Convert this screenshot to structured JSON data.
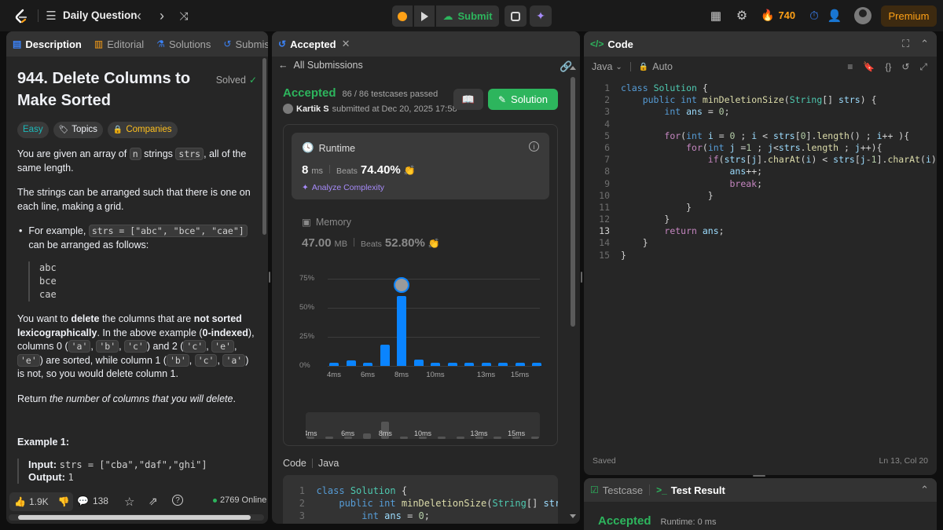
{
  "topbar": {
    "title": "Daily Question",
    "submit_label": "Submit",
    "streak": "740",
    "premium_label": "Premium"
  },
  "left": {
    "tabs": [
      {
        "label": "Description"
      },
      {
        "label": "Editorial"
      },
      {
        "label": "Solutions"
      },
      {
        "label": "Submissi"
      }
    ],
    "problem_title": "944. Delete Columns to Make Sorted",
    "solved_label": "Solved",
    "chips": {
      "difficulty": "Easy",
      "topics": "Topics",
      "companies": "Companies"
    },
    "p1": {
      "a": "You are given an array of ",
      "n": "n",
      "b": " strings ",
      "strs": "strs",
      "c": ", all of the same length."
    },
    "p2": "The strings can be arranged such that there is one on each line, making a grid.",
    "bullet": {
      "a": "For example, ",
      "code": "strs = [\"abc\", \"bce\", \"cae\"]",
      "b": " can be arranged as follows:"
    },
    "grid_lines": [
      "abc",
      "bce",
      "cae"
    ],
    "p3": {
      "a": "You want to ",
      "b": "delete",
      "c": " the columns that are ",
      "d": "not sorted lexicographically",
      "e": ". In the above example (",
      "f": "0-indexed",
      "g": "), columns 0 (",
      "c1": "'a'",
      "c2": "'b'",
      "c3": "'c'",
      "h": ") and 2 (",
      "c4": "'c'",
      "c5": "'e'",
      "c6": "'e'",
      "i": ") are sorted, while column 1 (",
      "c7": "'b'",
      "c8": "'c'",
      "c9": "'a'",
      "j": ") is not, so you would delete column 1."
    },
    "p4": {
      "a": "Return ",
      "b": "the number of columns that you will delete",
      "c": "."
    },
    "example_heading": "Example 1:",
    "example_input_label": "Input:",
    "example_input_value": "strs = [\"cba\",\"daf\",\"ghi\"]",
    "example_output_label": "Output:",
    "example_output_value": "1",
    "footer": {
      "likes": "1.9K",
      "comments": "138",
      "online": "2769 Online"
    }
  },
  "middle": {
    "tab_label": "Accepted",
    "all_submissions": "All Submissions",
    "status": "Accepted",
    "testcases": "86 / 86 testcases passed",
    "author": "Kartik S",
    "submitted_at": "submitted at Dec 20, 2025 17:58",
    "solution_label": "Solution",
    "runtime": {
      "label": "Runtime",
      "value": "8",
      "unit": "ms",
      "beats_label": "Beats",
      "beats": "74.40%",
      "analyze": "Analyze Complexity"
    },
    "memory": {
      "label": "Memory",
      "value": "47.00",
      "unit": "MB",
      "beats_label": "Beats",
      "beats": "52.80%"
    },
    "code_label": "Code",
    "code_lang": "Java",
    "code_preview": [
      "class Solution {",
      "    public int minDeletionSize(String[] strs",
      "        int ans = 0;"
    ]
  },
  "chart_data": {
    "type": "bar",
    "title": "",
    "xlabel": "",
    "ylabel": "",
    "ylim": [
      0,
      75
    ],
    "yticks": [
      "75%",
      "50%",
      "25%",
      "0%"
    ],
    "categories": [
      "4ms",
      "5ms",
      "6ms",
      "7ms",
      "8ms",
      "9ms",
      "10ms",
      "11ms",
      "12ms",
      "13ms",
      "14ms",
      "15ms",
      "16ms"
    ],
    "x_tick_labels": [
      "4ms",
      "6ms",
      "8ms",
      "10ms",
      "13ms",
      "15ms"
    ],
    "values": [
      2.5,
      4.5,
      3.0,
      18.5,
      60.0,
      5.5,
      2.5,
      2.5,
      2.5,
      2.5,
      2.5,
      2.5,
      2.5
    ],
    "highlight_category": "8ms",
    "bar_color": "#0a84ff",
    "grid": true
  },
  "right": {
    "tab_label": "Code",
    "language": "Java",
    "auto_label": "Auto",
    "code_lines": [
      "class Solution {",
      "    public int minDeletionSize(String[] strs) {",
      "        int ans = 0;",
      "",
      "        for(int i = 0 ; i < strs[0].length() ; i++ ){",
      "            for(int j =1 ; j<strs.length ; j++){",
      "                if(strs[j].charAt(i) < strs[j-1].charAt(i)){",
      "                    ans++;",
      "                    break;",
      "                }",
      "            }",
      "        }",
      "        return ans;",
      "    }",
      "}"
    ],
    "saved_label": "Saved",
    "cursor_pos": "Ln 13, Col 20",
    "bottom_tabs": {
      "testcase": "Testcase",
      "result": "Test Result"
    },
    "bottom_status": "Accepted",
    "bottom_runtime": "Runtime: 0 ms"
  },
  "colors": {
    "accent_green": "#2db55d",
    "easy_teal": "#1cbaba",
    "beats_gold": "#ffc01e",
    "bar_blue": "#0a84ff",
    "premium_orange": "#ffa116"
  }
}
